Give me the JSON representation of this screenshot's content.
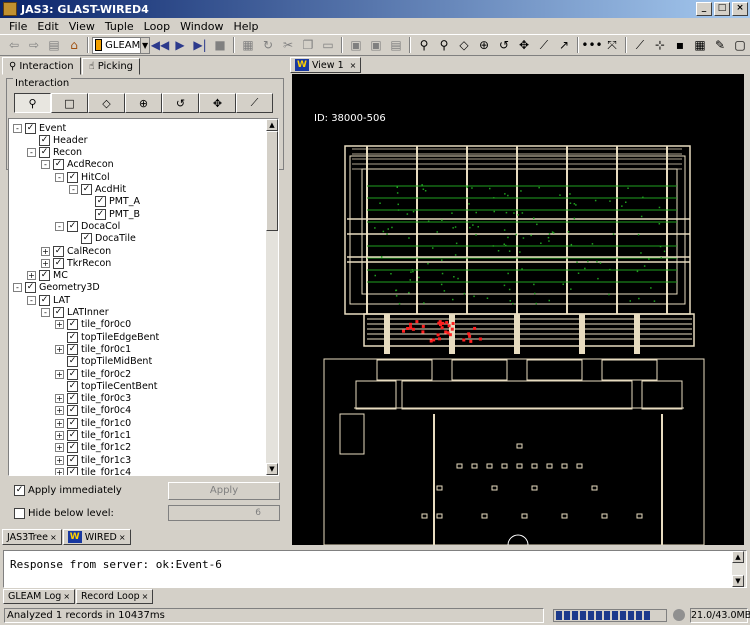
{
  "window": {
    "title": "JAS3: GLAST-WIRED4"
  },
  "menubar": {
    "items": [
      "File",
      "Edit",
      "View",
      "Tuple",
      "Loop",
      "Window",
      "Help"
    ]
  },
  "toolbar": {
    "combo_value": "GLEAM",
    "nav_icons": [
      "back-arrow-icon",
      "forward-arrow-icon",
      "page-icon",
      "home-icon"
    ],
    "playback_icons": [
      "rewind-icon",
      "play-icon",
      "step-forward-icon",
      "stop-icon"
    ]
  },
  "left_panel": {
    "tabs": [
      "Interaction",
      "Picking"
    ],
    "group_label": "Interaction",
    "modes": [
      "zoom",
      "rectangle",
      "pan",
      "rotate-3d",
      "rotate",
      "move",
      "measure"
    ],
    "tree": [
      {
        "label": "Event",
        "depth": 0,
        "exp": "-"
      },
      {
        "label": "Header",
        "depth": 1,
        "exp": ""
      },
      {
        "label": "Recon",
        "depth": 1,
        "exp": "-"
      },
      {
        "label": "AcdRecon",
        "depth": 2,
        "exp": "-"
      },
      {
        "label": "HitCol",
        "depth": 3,
        "exp": "-"
      },
      {
        "label": "AcdHit",
        "depth": 4,
        "exp": "-"
      },
      {
        "label": "PMT_A",
        "depth": 5,
        "exp": ""
      },
      {
        "label": "PMT_B",
        "depth": 5,
        "exp": ""
      },
      {
        "label": "DocaCol",
        "depth": 3,
        "exp": "-"
      },
      {
        "label": "DocaTile",
        "depth": 4,
        "exp": ""
      },
      {
        "label": "CalRecon",
        "depth": 2,
        "exp": "+"
      },
      {
        "label": "TkrRecon",
        "depth": 2,
        "exp": "+"
      },
      {
        "label": "MC",
        "depth": 1,
        "exp": "+"
      },
      {
        "label": "Geometry3D",
        "depth": 0,
        "exp": "-"
      },
      {
        "label": "LAT",
        "depth": 1,
        "exp": "-"
      },
      {
        "label": "LATInner",
        "depth": 2,
        "exp": "-"
      },
      {
        "label": "tile_f0r0c0",
        "depth": 3,
        "exp": "+"
      },
      {
        "label": "topTileEdgeBent",
        "depth": 3,
        "exp": ""
      },
      {
        "label": "tile_f0r0c1",
        "depth": 3,
        "exp": "+"
      },
      {
        "label": "topTileMidBent",
        "depth": 3,
        "exp": ""
      },
      {
        "label": "tile_f0r0c2",
        "depth": 3,
        "exp": "+"
      },
      {
        "label": "topTileCentBent",
        "depth": 3,
        "exp": ""
      },
      {
        "label": "tile_f0r0c3",
        "depth": 3,
        "exp": "+"
      },
      {
        "label": "tile_f0r0c4",
        "depth": 3,
        "exp": "+"
      },
      {
        "label": "tile_f0r1c0",
        "depth": 3,
        "exp": "+"
      },
      {
        "label": "tile_f0r1c1",
        "depth": 3,
        "exp": "+"
      },
      {
        "label": "tile_f0r1c2",
        "depth": 3,
        "exp": "+"
      },
      {
        "label": "tile_f0r1c3",
        "depth": 3,
        "exp": "+"
      },
      {
        "label": "tile_f0r1c4",
        "depth": 3,
        "exp": "+"
      }
    ],
    "apply_immediately_label": "Apply immediately",
    "apply_immediately_checked": true,
    "apply_button": "Apply",
    "hide_below_label": "Hide below level:",
    "hide_below_checked": false,
    "hide_below_value": "6"
  },
  "left_bottom_tabs": [
    "JAS3Tree",
    "WIRED"
  ],
  "view": {
    "tab_label": "View 1",
    "event_id": "ID: 38000-506"
  },
  "log": {
    "text": "Response from server: ok:Event-6",
    "tabs": [
      "GLEAM Log",
      "Record Loop"
    ]
  },
  "status": {
    "message": "Analyzed 1 records in 10437ms",
    "memory": "21.0/43.0MB",
    "progress_blocks": 12
  },
  "colors": {
    "title_start": "#0a246a",
    "title_end": "#a6caf0",
    "canvas_bg": "#000000",
    "detector_line": "#e8dcc0",
    "track_green": "#1fa01f",
    "hit_red": "#ff2020",
    "progress_blue": "#1c3a8c"
  }
}
